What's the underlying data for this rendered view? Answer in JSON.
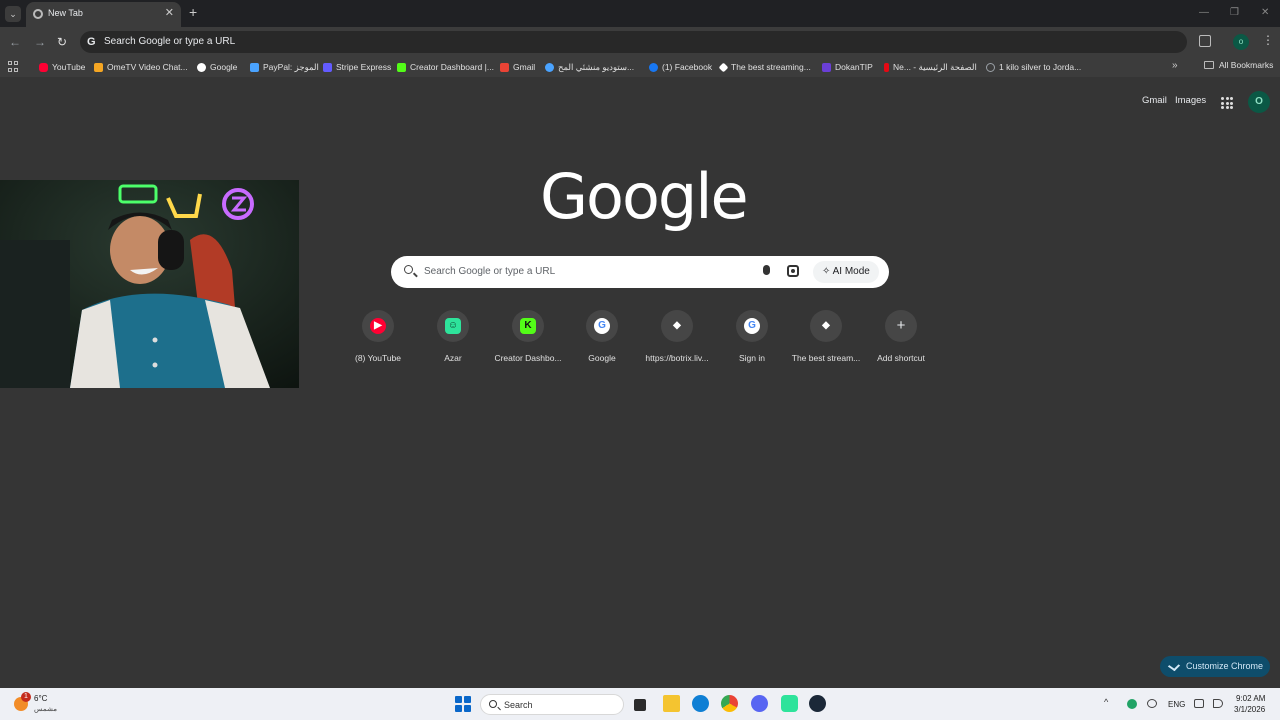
{
  "browser": {
    "tab_title": "New Tab",
    "new_tab_symbol": "+",
    "address_placeholder": "Search Google or type a URL",
    "profile_initial": "o"
  },
  "bookmarks": [
    {
      "label": "YouTube",
      "icon": "youtube-icon",
      "color": "#ff0033"
    },
    {
      "label": "OmeTV Video Chat...",
      "icon": "ometv-icon",
      "color": "#f5a623"
    },
    {
      "label": "Google",
      "icon": "google-icon",
      "color": "#ffffff"
    },
    {
      "label": "PayPal: الموجز",
      "icon": "paypal-icon",
      "color": "#4aa3ff"
    },
    {
      "label": "Stripe Express",
      "icon": "stripe-icon",
      "color": "#635bff"
    },
    {
      "label": "Creator Dashboard |...",
      "icon": "kick-icon",
      "color": "#53fc18"
    },
    {
      "label": "Gmail",
      "icon": "gmail-icon",
      "color": "#ea4335"
    },
    {
      "label": "ستوديو منشئي المح...",
      "icon": "meta-icon",
      "color": "#4aa3ff"
    },
    {
      "label": "(1) Facebook",
      "icon": "facebook-icon",
      "color": "#1877f2"
    },
    {
      "label": "The best streaming...",
      "icon": "diamond-icon",
      "color": "#ffffff"
    },
    {
      "label": "DokanTIP",
      "icon": "dokantip-icon",
      "color": "#6a3fd6"
    },
    {
      "label": "Ne... - الصفحة الرئيسية",
      "icon": "netflix-icon",
      "color": "#e50914"
    },
    {
      "label": "1 kilo silver to Jorda...",
      "icon": "globe-icon",
      "color": "#9aa0a6"
    }
  ],
  "all_bookmarks_label": "All Bookmarks",
  "page": {
    "gmail_link": "Gmail",
    "images_link": "Images",
    "profile_initial": "O",
    "logo_text": "Google",
    "search_placeholder": "Search Google or type a URL",
    "ai_mode_label": "AI Mode",
    "customize_label": "Customize Chrome"
  },
  "shortcuts": [
    {
      "label": "(8) YouTube",
      "icon": "youtube-icon",
      "color": "#ff0033",
      "glyph": "▶"
    },
    {
      "label": "Azar",
      "icon": "azar-icon",
      "color": "#2ee39b",
      "glyph": "☺"
    },
    {
      "label": "Creator Dashbo...",
      "icon": "kick-icon",
      "color": "#53fc18",
      "glyph": "K"
    },
    {
      "label": "Google",
      "icon": "google-icon",
      "color": "#ffffff",
      "glyph": "G"
    },
    {
      "label": "https://botrix.liv...",
      "icon": "diamond-icon",
      "color": "#ffffff",
      "glyph": "◆"
    },
    {
      "label": "Sign in",
      "icon": "google-icon",
      "color": "#ffffff",
      "glyph": "G"
    },
    {
      "label": "The best stream...",
      "icon": "diamond-icon",
      "color": "#ffffff",
      "glyph": "◆"
    },
    {
      "label": "Add shortcut",
      "icon": "plus-icon",
      "color": "#e8eaed",
      "glyph": "+"
    }
  ],
  "taskbar": {
    "temperature": "6°C",
    "weather_desc": "مشمس",
    "weather_badge": "1",
    "search_label": "Search",
    "language": "ENG",
    "time": "9:02 AM",
    "date": "3/1/2026"
  }
}
